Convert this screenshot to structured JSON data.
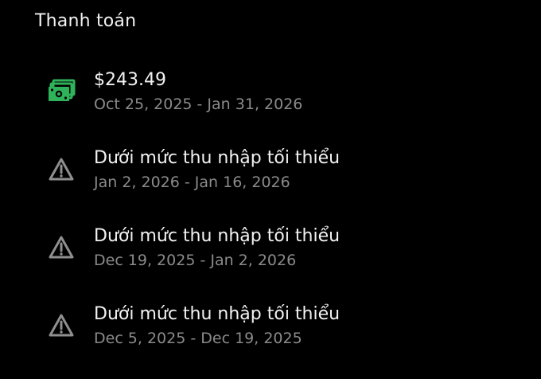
{
  "section": {
    "title": "Thanh toán"
  },
  "colors": {
    "background": "#000000",
    "primary_text": "#f2f2f2",
    "secondary_text": "#8a8a8a",
    "payment_icon": "#2fb35a",
    "warning_icon": "#8f8f8f"
  },
  "payments": [
    {
      "icon": "cash-icon",
      "title": "$243.49",
      "period": "Oct 25, 2025 - Jan 31, 2026"
    },
    {
      "icon": "warning-icon",
      "title": "Dưới mức thu nhập tối thiểu",
      "period": "Jan 2, 2026 - Jan 16, 2026"
    },
    {
      "icon": "warning-icon",
      "title": "Dưới mức thu nhập tối thiểu",
      "period": "Dec 19, 2025 - Jan 2, 2026"
    },
    {
      "icon": "warning-icon",
      "title": "Dưới mức thu nhập tối thiểu",
      "period": "Dec 5, 2025 - Dec 19, 2025"
    }
  ]
}
